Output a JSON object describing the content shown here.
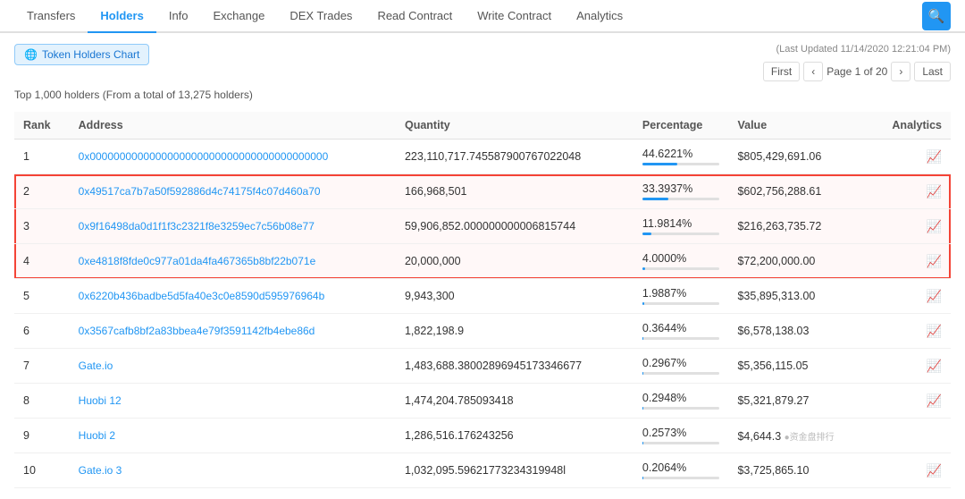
{
  "nav": {
    "items": [
      {
        "label": "Transfers",
        "active": false
      },
      {
        "label": "Holders",
        "active": true
      },
      {
        "label": "Info",
        "active": false
      },
      {
        "label": "Exchange",
        "active": false
      },
      {
        "label": "DEX Trades",
        "active": false
      },
      {
        "label": "Read Contract",
        "active": false
      },
      {
        "label": "Write Contract",
        "active": false
      },
      {
        "label": "Analytics",
        "active": false
      }
    ],
    "search_icon": "🔍"
  },
  "chart_btn": "Token Holders Chart",
  "last_updated": "(Last Updated 11/14/2020 12:21:04 PM)",
  "holders_info": "Top 1,000 holders (From a total of 13,275 holders)",
  "pagination": {
    "first": "First",
    "prev": "‹",
    "page_info": "Page 1 of 20",
    "next": "›",
    "last": "Last"
  },
  "columns": {
    "rank": "Rank",
    "address": "Address",
    "quantity": "Quantity",
    "percentage": "Percentage",
    "value": "Value",
    "analytics": "Analytics"
  },
  "rows": [
    {
      "rank": "1",
      "address": "0x0000000000000000000000000000000000000000",
      "address_type": "hash",
      "quantity": "223,110,717.745587900767022048",
      "percentage": "44.6221%",
      "pct_value": 44.6221,
      "value": "$805,429,691.06",
      "highlight": false
    },
    {
      "rank": "2",
      "address": "0x49517ca7b7a50f592886d4c74175f4c07d460a70",
      "address_type": "hash",
      "quantity": "166,968,501",
      "percentage": "33.3937%",
      "pct_value": 33.3937,
      "value": "$602,756,288.61",
      "highlight": true
    },
    {
      "rank": "3",
      "address": "0x9f16498da0d1f1f3c2321f8e3259ec7c56b08e77",
      "address_type": "hash",
      "quantity": "59,906,852.000000000006815744",
      "percentage": "11.9814%",
      "pct_value": 11.9814,
      "value": "$216,263,735.72",
      "highlight": true
    },
    {
      "rank": "4",
      "address": "0xe4818f8fde0c977a01da4fa467365b8bf22b071e",
      "address_type": "hash",
      "quantity": "20,000,000",
      "percentage": "4.0000%",
      "pct_value": 4.0,
      "value": "$72,200,000.00",
      "highlight": true
    },
    {
      "rank": "5",
      "address": "0x6220b436badbe5d5fa40e3c0e8590d595976964b",
      "address_type": "hash",
      "quantity": "9,943,300",
      "percentage": "1.9887%",
      "pct_value": 1.9887,
      "value": "$35,895,313.00",
      "highlight": false
    },
    {
      "rank": "6",
      "address": "0x3567cafb8bf2a83bbea4e79f3591142fb4ebe86d",
      "address_type": "hash",
      "quantity": "1,822,198.9",
      "percentage": "0.3644%",
      "pct_value": 0.3644,
      "value": "$6,578,138.03",
      "highlight": false
    },
    {
      "rank": "7",
      "address": "Gate.io",
      "address_type": "name",
      "quantity": "1,483,688.38002896945173346677",
      "percentage": "0.2967%",
      "pct_value": 0.2967,
      "value": "$5,356,115.05",
      "highlight": false
    },
    {
      "rank": "8",
      "address": "Huobi 12",
      "address_type": "name",
      "quantity": "1,474,204.785093418",
      "percentage": "0.2948%",
      "pct_value": 0.2948,
      "value": "$5,321,879.27",
      "highlight": false
    },
    {
      "rank": "9",
      "address": "Huobi 2",
      "address_type": "name",
      "quantity": "1,286,516.176243256",
      "percentage": "0.2573%",
      "pct_value": 0.2573,
      "value": "$4,644.3",
      "watermark": true,
      "highlight": false
    },
    {
      "rank": "10",
      "address": "Gate.io 3",
      "address_type": "name",
      "quantity": "1,032,095.59621773234319948l",
      "percentage": "0.2064%",
      "pct_value": 0.2064,
      "value": "$3,725,865.10",
      "highlight": false
    }
  ]
}
